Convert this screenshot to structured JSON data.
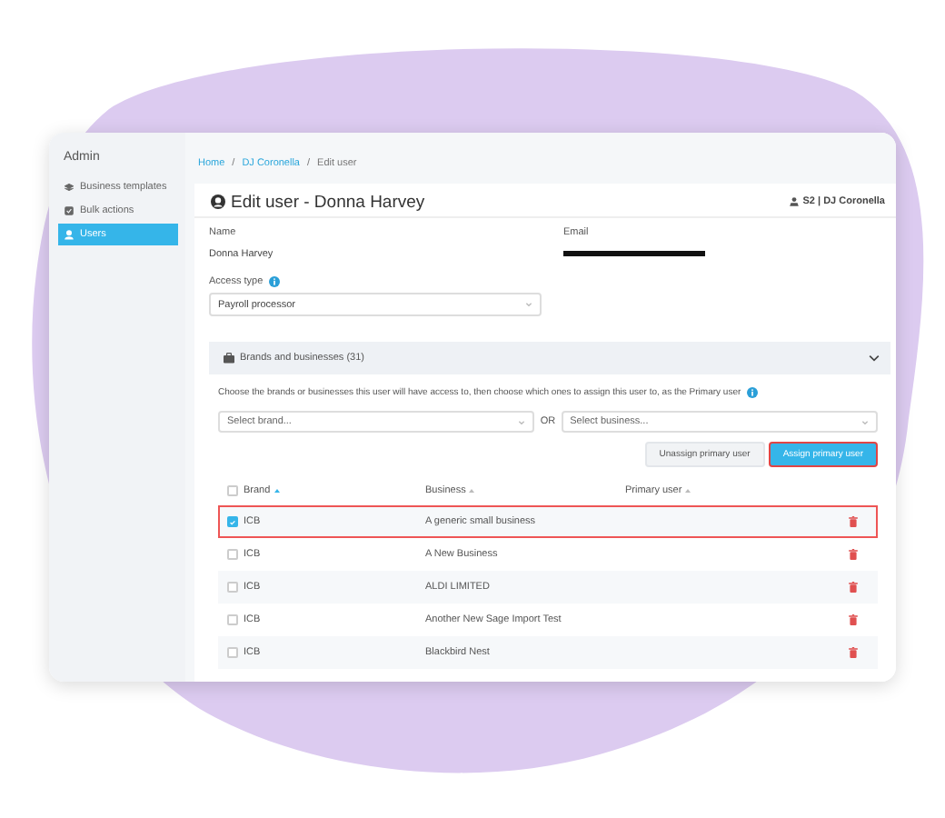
{
  "sidebar": {
    "title": "Admin",
    "items": [
      {
        "label": "Business templates",
        "selected": false
      },
      {
        "label": "Bulk actions",
        "selected": false
      },
      {
        "label": "Users",
        "selected": true
      }
    ]
  },
  "breadcrumb_separator": "/",
  "breadcrumb": [
    {
      "label": "Home",
      "link": true
    },
    {
      "label": "DJ Coronella",
      "link": true
    },
    {
      "label": "Edit user",
      "link": false
    }
  ],
  "page": {
    "title": "Edit user - Donna Harvey",
    "account": "S2 | DJ Coronella"
  },
  "fields": {
    "name_label": "Name",
    "name_value": "Donna Harvey",
    "email_label": "Email",
    "access_label": "Access type",
    "access_value": "Payroll processor"
  },
  "brands": {
    "title": "Brands and businesses (31)",
    "expanded": true,
    "hint": "Choose the brands or businesses this user will have access to, then choose which ones to assign this user to, as the Primary user",
    "brand_placeholder": "Select brand...",
    "or": "OR",
    "business_placeholder": "Select business...",
    "buttons": [
      {
        "label": "Unassign primary user",
        "kind": "secondary"
      },
      {
        "label": "Assign primary user",
        "kind": "primary"
      }
    ]
  },
  "table": {
    "all_checked": false,
    "columns": [
      "Brand",
      "Business",
      "Primary user"
    ],
    "rows": [
      {
        "brand": "ICB",
        "business": "A generic small business",
        "selected": true
      },
      {
        "brand": "ICB",
        "business": "A New Business",
        "selected": false
      },
      {
        "brand": "ICB",
        "business": "ALDI LIMITED",
        "selected": false
      },
      {
        "brand": "ICB",
        "business": "Another New Sage Import Test",
        "selected": false
      },
      {
        "brand": "ICB",
        "business": "Blackbird Nest",
        "selected": false
      }
    ]
  }
}
